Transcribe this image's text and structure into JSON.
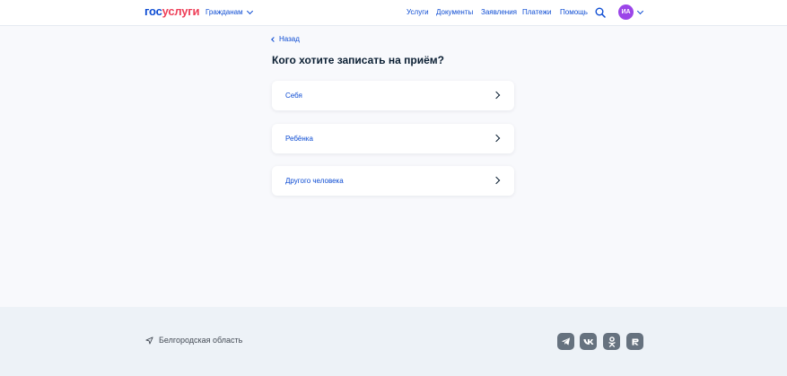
{
  "header": {
    "logo_part1": "гос",
    "logo_part2": "услуги",
    "citizens": "Гражданам",
    "nav": [
      "Услуги",
      "Документы",
      "Заявления",
      "Платежи",
      "Помощь"
    ],
    "avatar_initials": "ИА"
  },
  "main": {
    "back": "Назад",
    "title": "Кого хотите записать на приём?",
    "options": [
      "Себя",
      "Ребёнка",
      "Другого человека"
    ]
  },
  "footer": {
    "region": "Белгородская область",
    "socials": [
      "telegram-icon",
      "vk-icon",
      "odnoklassniki-icon",
      "rutube-icon"
    ]
  },
  "colors": {
    "accent": "#0d4cd3",
    "logo_red": "#ee3f58",
    "avatar": "#9b45e8",
    "page_bg": "#f8f9fc",
    "footer_bg": "#edf2f7",
    "social_bg": "#66727f"
  }
}
